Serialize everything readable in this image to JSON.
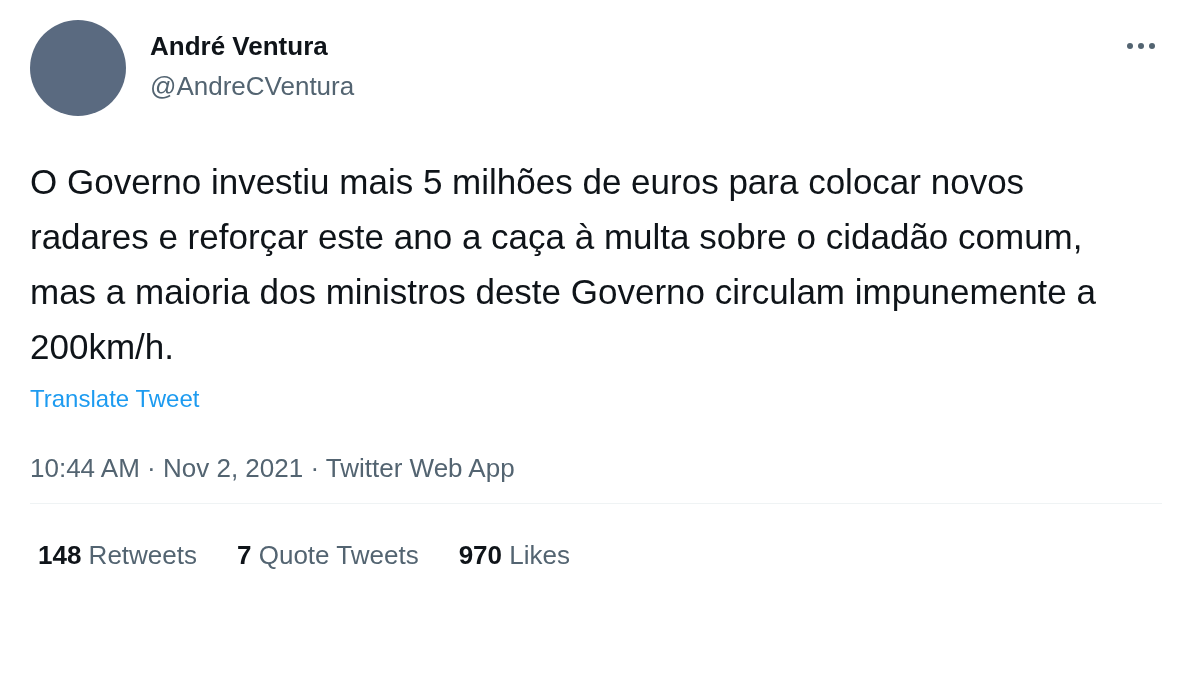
{
  "author": {
    "name": "André Ventura",
    "handle": "@AndreCVentura"
  },
  "tweet": {
    "text": "O Governo investiu mais 5 milhões de euros para colocar novos radares e reforçar este ano a caça à multa sobre o cidadão comum, mas a maioria dos ministros deste Governo circulam impunemente a 200km/h.",
    "translate": "Translate Tweet",
    "meta": "10:44 AM · Nov 2, 2021 · Twitter Web App"
  },
  "stats": [
    {
      "count": "148",
      "label": "Retweets"
    },
    {
      "count": "7",
      "label": "Quote Tweets"
    },
    {
      "count": "970",
      "label": "Likes"
    }
  ]
}
